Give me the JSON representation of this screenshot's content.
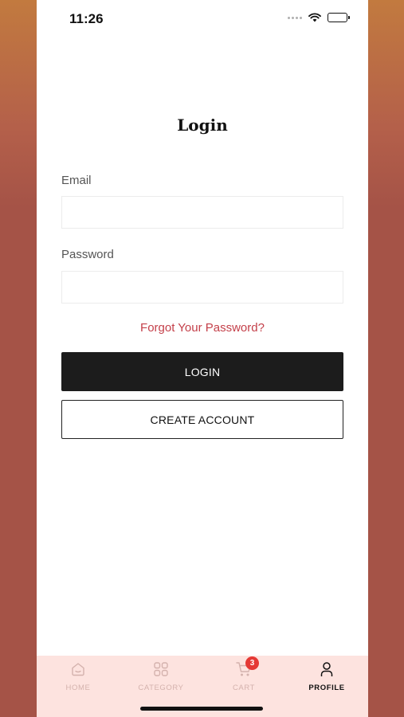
{
  "status_bar": {
    "time": "11:26",
    "icons": [
      "signal-dots-icon",
      "wifi-icon",
      "battery-icon"
    ]
  },
  "page": {
    "title": "Login"
  },
  "form": {
    "email_label": "Email",
    "email_value": "",
    "password_label": "Password",
    "password_value": "",
    "forgot_password": "Forgot Your Password?",
    "login_button": "LOGIN",
    "create_account_button": "CREATE ACCOUNT"
  },
  "tab_bar": {
    "items": [
      {
        "label": "HOME",
        "icon": "home-icon",
        "active": false
      },
      {
        "label": "CATEGORY",
        "icon": "grid-icon",
        "active": false
      },
      {
        "label": "CART",
        "icon": "cart-icon",
        "active": false,
        "badge": "3"
      },
      {
        "label": "PROFILE",
        "icon": "person-icon",
        "active": true
      }
    ]
  },
  "colors": {
    "accent_link": "#c4404a",
    "primary_button": "#1c1c1c",
    "tab_bar_bg": "#fde3df",
    "badge": "#e53935",
    "inactive_tab": "#d4b2ad"
  }
}
